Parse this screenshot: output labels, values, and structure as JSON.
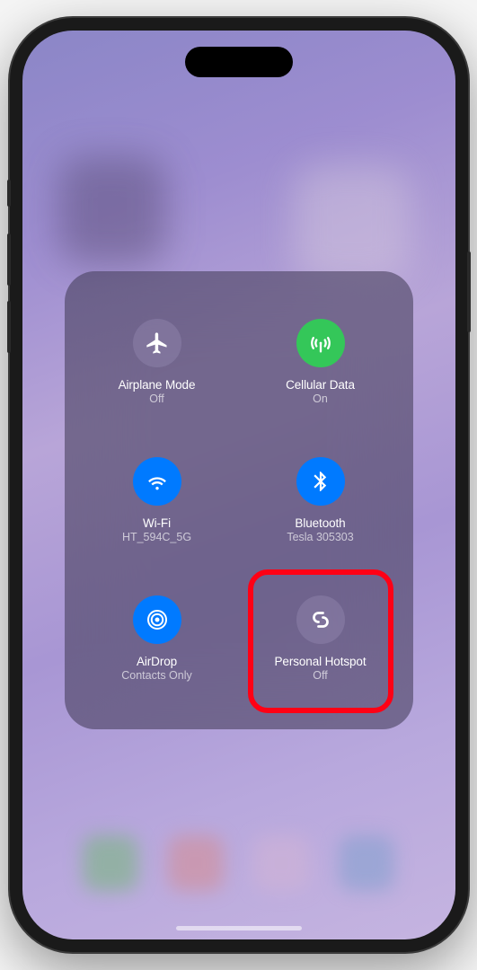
{
  "controls": {
    "airplane": {
      "title": "Airplane Mode",
      "status": "Off"
    },
    "cellular": {
      "title": "Cellular Data",
      "status": "On"
    },
    "wifi": {
      "title": "Wi-Fi",
      "status": "HT_594C_5G"
    },
    "bluetooth": {
      "title": "Bluetooth",
      "status": "Tesla 305303"
    },
    "airdrop": {
      "title": "AirDrop",
      "status": "Contacts Only"
    },
    "hotspot": {
      "title": "Personal Hotspot",
      "status": "Off"
    }
  }
}
